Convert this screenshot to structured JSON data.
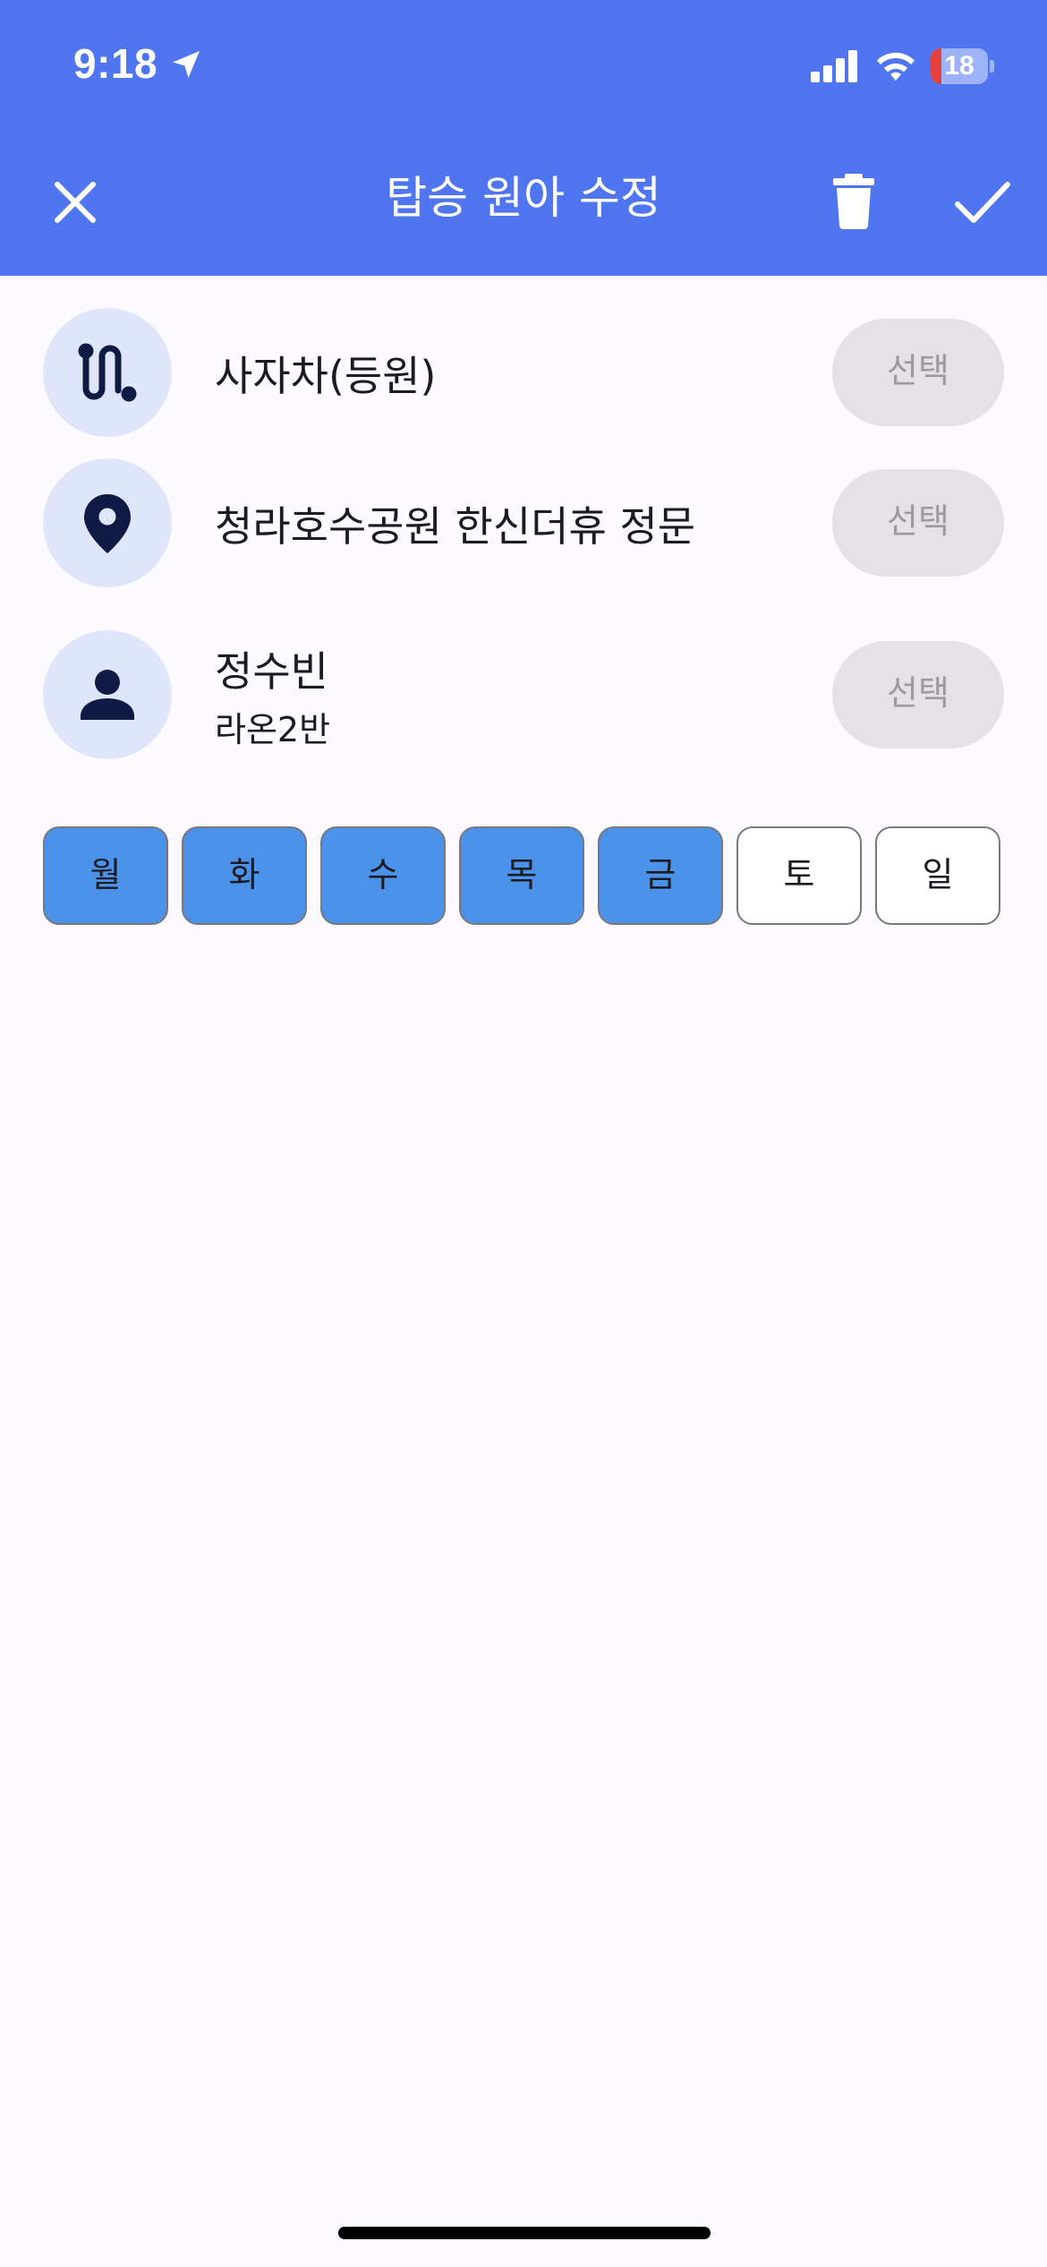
{
  "status_bar": {
    "time": "9:18",
    "battery_level": "18",
    "location_icon": "location-arrow-icon",
    "signal_icon": "cellular-signal-icon",
    "wifi_icon": "wifi-icon",
    "battery_icon": "battery-icon"
  },
  "header": {
    "title": "탑승 원아 수정",
    "close_icon": "close-icon",
    "delete_icon": "trash-icon",
    "confirm_icon": "check-icon",
    "background_color": "#4f75f0"
  },
  "form": {
    "route": {
      "icon": "route-icon",
      "value": "사자차(등원)",
      "button_label": "선택"
    },
    "location": {
      "icon": "location-pin-icon",
      "value": "청라호수공원 한신더휴 정문",
      "button_label": "선택"
    },
    "child": {
      "icon": "person-icon",
      "name": "정수빈",
      "class_name": "라온2반",
      "button_label": "선택"
    }
  },
  "days": [
    {
      "label": "월",
      "selected": true
    },
    {
      "label": "화",
      "selected": true
    },
    {
      "label": "수",
      "selected": true
    },
    {
      "label": "목",
      "selected": true
    },
    {
      "label": "금",
      "selected": true
    },
    {
      "label": "토",
      "selected": false
    },
    {
      "label": "일",
      "selected": false
    }
  ],
  "colors": {
    "accent": "#4f75f0",
    "day_selected": "#4b93ea",
    "icon_circle": "#dfe6fc",
    "icon_fill": "#0f1b45",
    "select_button_bg": "#e4e2e6",
    "select_button_text": "#9c9aa0"
  }
}
